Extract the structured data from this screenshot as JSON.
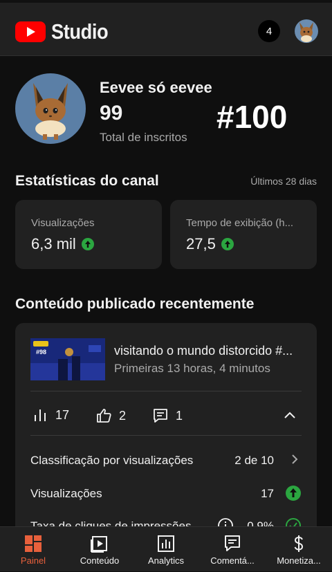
{
  "header": {
    "app_name": "Studio",
    "notification_count": "4"
  },
  "channel": {
    "name": "Eevee só eevee",
    "subscribers": "99",
    "subscribers_label": "Total de inscritos",
    "overlay_text": "#100"
  },
  "stats": {
    "title": "Estatísticas do canal",
    "period": "Últimos 28 dias",
    "cards": [
      {
        "label": "Visualizações",
        "value": "6,3 mil",
        "trend": "up"
      },
      {
        "label": "Tempo de exibição (h...",
        "value": "27,5",
        "trend": "up"
      }
    ]
  },
  "recent": {
    "title": "Conteúdo publicado recentemente",
    "video": {
      "title": "visitando o mundo distorcido #...",
      "subtitle": "Primeiras 13 horas, 4 minutos",
      "thumb_text": "#98",
      "views": "17",
      "likes": "2",
      "comments": "1"
    },
    "rows": [
      {
        "label": "Classificação por visualizações",
        "value": "2 de 10",
        "icon": "chevron-right-icon"
      },
      {
        "label": "Visualizações",
        "value": "17",
        "icon": "arrow-up-icon"
      },
      {
        "label": "Taxa de cliques de impressões",
        "value": "0,9%",
        "icon": "check-icon"
      }
    ]
  },
  "nav": [
    {
      "label": "Painel",
      "icon": "dashboard-icon",
      "active": true
    },
    {
      "label": "Conteúdo",
      "icon": "content-icon",
      "active": false
    },
    {
      "label": "Analytics",
      "icon": "analytics-icon",
      "active": false
    },
    {
      "label": "Comentá...",
      "icon": "comments-icon",
      "active": false
    },
    {
      "label": "Monetiza...",
      "icon": "dollar-icon",
      "active": false
    }
  ],
  "colors": {
    "accent_red": "#ff0000",
    "active_orange": "#e8603c",
    "trend_green": "#2ba640"
  }
}
